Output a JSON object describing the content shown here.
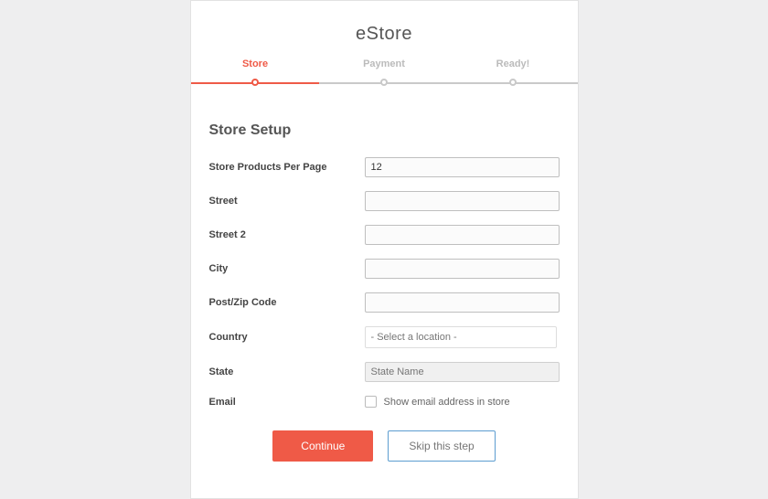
{
  "app_title": "eStore",
  "stepper": {
    "steps": [
      {
        "label": "Store",
        "active": true
      },
      {
        "label": "Payment",
        "active": false
      },
      {
        "label": "Ready!",
        "active": false
      }
    ]
  },
  "form": {
    "heading": "Store Setup",
    "products_per_page": {
      "label": "Store Products Per Page",
      "value": "12"
    },
    "street": {
      "label": "Street",
      "value": ""
    },
    "street2": {
      "label": "Street 2",
      "value": ""
    },
    "city": {
      "label": "City",
      "value": ""
    },
    "postcode": {
      "label": "Post/Zip Code",
      "value": ""
    },
    "country": {
      "label": "Country",
      "placeholder": "- Select a location -"
    },
    "state": {
      "label": "State",
      "placeholder": "State Name"
    },
    "email": {
      "label": "Email",
      "checkbox_label": "Show email address in store"
    }
  },
  "buttons": {
    "continue": "Continue",
    "skip": "Skip this step"
  }
}
